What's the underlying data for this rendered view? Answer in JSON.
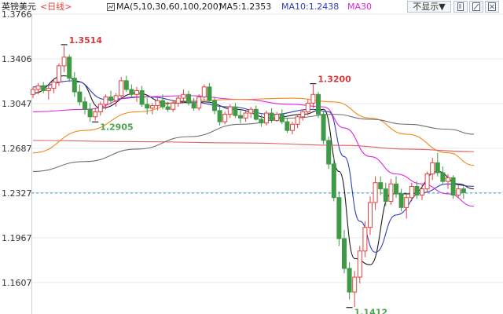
{
  "header": {
    "symbol": "英镑美元",
    "period": "<日线>",
    "indicator": "MA(5,10,30,60,100,200)",
    "ma5_label": "MA5:1.2353",
    "ma10_label": "MA10:1.2438",
    "ma30_label": "MA30",
    "dropdown_label": "不显示▼",
    "icons": [
      "doc-icon",
      "scale-icon",
      "close-icon"
    ]
  },
  "colors": {
    "up": "#e4403f",
    "down": "#3f9a45",
    "ma5": "#1a1a1a",
    "ma10": "#2f3bbf",
    "ma30": "#e024e0",
    "ma60": "#f08c1e",
    "ma100": "#e06060",
    "ma200": "#707070",
    "current_line": "#2f8fd8",
    "grid": "#e8e8e8",
    "axis_text": "#333333"
  },
  "chart_data": {
    "type": "candlestick",
    "title": "英镑美元",
    "y_ticks": [
      "1.3766",
      "1.3406",
      "1.3047",
      "1.2687",
      "1.2327",
      "1.1967",
      "1.1607"
    ],
    "ylim": [
      1.1366,
      1.3766
    ],
    "current_price_line": 1.2327,
    "annotations": [
      {
        "label": "1.3514",
        "value": 1.3514,
        "kind": "high"
      },
      {
        "label": "1.2905",
        "value": 1.2905,
        "kind": "low"
      },
      {
        "label": "1.3200",
        "value": 1.32,
        "kind": "high"
      },
      {
        "label": "1.1412",
        "value": 1.1412,
        "kind": "low"
      }
    ],
    "candles": [
      [
        1.312,
        1.318,
        1.309,
        1.316
      ],
      [
        1.316,
        1.321,
        1.312,
        1.319
      ],
      [
        1.319,
        1.322,
        1.313,
        1.315
      ],
      [
        1.315,
        1.32,
        1.308,
        1.317
      ],
      [
        1.317,
        1.325,
        1.313,
        1.322
      ],
      [
        1.322,
        1.337,
        1.319,
        1.335
      ],
      [
        1.335,
        1.351,
        1.33,
        1.342
      ],
      [
        1.342,
        1.344,
        1.322,
        1.325
      ],
      [
        1.325,
        1.33,
        1.31,
        1.314
      ],
      [
        1.314,
        1.32,
        1.303,
        1.306
      ],
      [
        1.306,
        1.31,
        1.296,
        1.3
      ],
      [
        1.3,
        1.305,
        1.29,
        1.294
      ],
      [
        1.294,
        1.301,
        1.291,
        1.298
      ],
      [
        1.298,
        1.306,
        1.295,
        1.304
      ],
      [
        1.304,
        1.312,
        1.3,
        1.31
      ],
      [
        1.31,
        1.315,
        1.304,
        1.307
      ],
      [
        1.307,
        1.313,
        1.302,
        1.311
      ],
      [
        1.311,
        1.326,
        1.309,
        1.323
      ],
      [
        1.323,
        1.327,
        1.314,
        1.316
      ],
      [
        1.316,
        1.32,
        1.309,
        1.312
      ],
      [
        1.312,
        1.318,
        1.306,
        1.315
      ],
      [
        1.315,
        1.319,
        1.302,
        1.304
      ],
      [
        1.304,
        1.309,
        1.296,
        1.301
      ],
      [
        1.301,
        1.305,
        1.296,
        1.303
      ],
      [
        1.303,
        1.309,
        1.299,
        1.307
      ],
      [
        1.307,
        1.312,
        1.3,
        1.302
      ],
      [
        1.302,
        1.306,
        1.298,
        1.3
      ],
      [
        1.3,
        1.307,
        1.298,
        1.305
      ],
      [
        1.305,
        1.311,
        1.302,
        1.309
      ],
      [
        1.309,
        1.316,
        1.305,
        1.312
      ],
      [
        1.312,
        1.315,
        1.303,
        1.305
      ],
      [
        1.305,
        1.309,
        1.299,
        1.301
      ],
      [
        1.301,
        1.312,
        1.299,
        1.31
      ],
      [
        1.31,
        1.32,
        1.307,
        1.318
      ],
      [
        1.318,
        1.321,
        1.305,
        1.307
      ],
      [
        1.307,
        1.31,
        1.296,
        1.299
      ],
      [
        1.299,
        1.302,
        1.287,
        1.29
      ],
      [
        1.29,
        1.298,
        1.288,
        1.296
      ],
      [
        1.296,
        1.304,
        1.293,
        1.302
      ],
      [
        1.302,
        1.305,
        1.293,
        1.295
      ],
      [
        1.295,
        1.3,
        1.289,
        1.293
      ],
      [
        1.293,
        1.299,
        1.29,
        1.297
      ],
      [
        1.297,
        1.302,
        1.293,
        1.3
      ],
      [
        1.3,
        1.303,
        1.291,
        1.292
      ],
      [
        1.292,
        1.296,
        1.286,
        1.289
      ],
      [
        1.289,
        1.299,
        1.287,
        1.297
      ],
      [
        1.297,
        1.301,
        1.289,
        1.291
      ],
      [
        1.291,
        1.298,
        1.29,
        1.296
      ],
      [
        1.296,
        1.3,
        1.288,
        1.29
      ],
      [
        1.29,
        1.293,
        1.281,
        1.283
      ],
      [
        1.283,
        1.29,
        1.28,
        1.288
      ],
      [
        1.288,
        1.296,
        1.285,
        1.294
      ],
      [
        1.294,
        1.3,
        1.291,
        1.298
      ],
      [
        1.298,
        1.308,
        1.295,
        1.305
      ],
      [
        1.305,
        1.32,
        1.301,
        1.312
      ],
      [
        1.312,
        1.314,
        1.293,
        1.296
      ],
      [
        1.296,
        1.298,
        1.272,
        1.275
      ],
      [
        1.275,
        1.278,
        1.252,
        1.256
      ],
      [
        1.256,
        1.262,
        1.226,
        1.229
      ],
      [
        1.229,
        1.234,
        1.19,
        1.196
      ],
      [
        1.196,
        1.203,
        1.168,
        1.172
      ],
      [
        1.172,
        1.177,
        1.147,
        1.153
      ],
      [
        1.153,
        1.17,
        1.141,
        1.165
      ],
      [
        1.165,
        1.19,
        1.16,
        1.186
      ],
      [
        1.186,
        1.21,
        1.181,
        1.205
      ],
      [
        1.205,
        1.23,
        1.199,
        1.225
      ],
      [
        1.225,
        1.246,
        1.219,
        1.241
      ],
      [
        1.241,
        1.246,
        1.231,
        1.236
      ],
      [
        1.236,
        1.241,
        1.222,
        1.226
      ],
      [
        1.226,
        1.244,
        1.223,
        1.24
      ],
      [
        1.24,
        1.246,
        1.229,
        1.232
      ],
      [
        1.232,
        1.236,
        1.218,
        1.221
      ],
      [
        1.221,
        1.232,
        1.212,
        1.229
      ],
      [
        1.229,
        1.241,
        1.226,
        1.238
      ],
      [
        1.238,
        1.242,
        1.228,
        1.231
      ],
      [
        1.231,
        1.239,
        1.227,
        1.236
      ],
      [
        1.236,
        1.25,
        1.233,
        1.248
      ],
      [
        1.248,
        1.261,
        1.243,
        1.257
      ],
      [
        1.257,
        1.265,
        1.246,
        1.249
      ],
      [
        1.249,
        1.254,
        1.24,
        1.242
      ],
      [
        1.242,
        1.248,
        1.236,
        1.245
      ],
      [
        1.245,
        1.247,
        1.228,
        1.231
      ],
      [
        1.231,
        1.239,
        1.229,
        1.236
      ],
      [
        1.236,
        1.238,
        1.228,
        1.233
      ]
    ],
    "ma_series": [
      {
        "name": "MA5",
        "points": [
          [
            0,
            1.313
          ],
          [
            6,
            1.327
          ],
          [
            9,
            1.322
          ],
          [
            13,
            1.301
          ],
          [
            20,
            1.313
          ],
          [
            26,
            1.305
          ],
          [
            33,
            1.306
          ],
          [
            39,
            1.3
          ],
          [
            46,
            1.293
          ],
          [
            52,
            1.296
          ],
          [
            56,
            1.3
          ],
          [
            59,
            1.25
          ],
          [
            62,
            1.18
          ],
          [
            65,
            1.175
          ],
          [
            69,
            1.232
          ],
          [
            73,
            1.232
          ],
          [
            78,
            1.25
          ],
          [
            82,
            1.24
          ],
          [
            85,
            1.236
          ]
        ]
      },
      {
        "name": "MA10",
        "points": [
          [
            0,
            1.318
          ],
          [
            8,
            1.323
          ],
          [
            14,
            1.308
          ],
          [
            22,
            1.31
          ],
          [
            30,
            1.306
          ],
          [
            38,
            1.302
          ],
          [
            46,
            1.296
          ],
          [
            54,
            1.3
          ],
          [
            57,
            1.298
          ],
          [
            60,
            1.262
          ],
          [
            63,
            1.21
          ],
          [
            66,
            1.185
          ],
          [
            70,
            1.215
          ],
          [
            75,
            1.233
          ],
          [
            80,
            1.24
          ],
          [
            85,
            1.238
          ]
        ]
      },
      {
        "name": "MA30",
        "points": [
          [
            0,
            1.298
          ],
          [
            10,
            1.3
          ],
          [
            20,
            1.31
          ],
          [
            30,
            1.311
          ],
          [
            40,
            1.308
          ],
          [
            50,
            1.304
          ],
          [
            56,
            1.302
          ],
          [
            60,
            1.285
          ],
          [
            65,
            1.262
          ],
          [
            70,
            1.248
          ],
          [
            75,
            1.24
          ],
          [
            80,
            1.232
          ],
          [
            85,
            1.222
          ]
        ]
      },
      {
        "name": "MA60",
        "points": [
          [
            0,
            1.265
          ],
          [
            10,
            1.283
          ],
          [
            20,
            1.298
          ],
          [
            30,
            1.307
          ],
          [
            40,
            1.308
          ],
          [
            50,
            1.309
          ],
          [
            58,
            1.306
          ],
          [
            65,
            1.293
          ],
          [
            72,
            1.28
          ],
          [
            80,
            1.265
          ],
          [
            85,
            1.255
          ]
        ]
      },
      {
        "name": "MA100",
        "points": [
          [
            0,
            1.275
          ],
          [
            20,
            1.274
          ],
          [
            40,
            1.273
          ],
          [
            60,
            1.271
          ],
          [
            72,
            1.268
          ],
          [
            85,
            1.266
          ]
        ]
      },
      {
        "name": "MA200",
        "points": [
          [
            0,
            1.25
          ],
          [
            10,
            1.258
          ],
          [
            20,
            1.268
          ],
          [
            30,
            1.278
          ],
          [
            40,
            1.288
          ],
          [
            50,
            1.293
          ],
          [
            58,
            1.296
          ],
          [
            65,
            1.292
          ],
          [
            72,
            1.288
          ],
          [
            80,
            1.284
          ],
          [
            85,
            1.28
          ]
        ]
      }
    ],
    "grid": true
  }
}
